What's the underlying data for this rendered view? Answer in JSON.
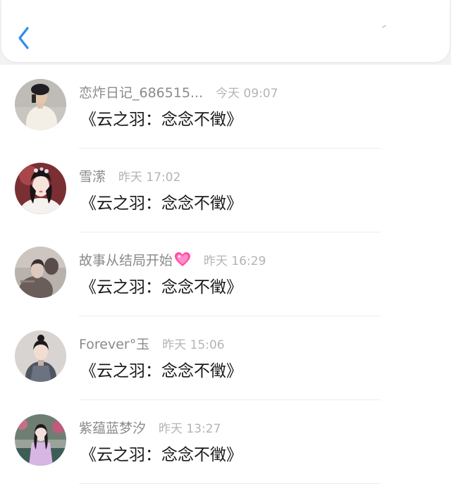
{
  "header": {
    "back_icon": "chevron-left-icon",
    "accent_color": "#2f8cf2"
  },
  "messages": [
    {
      "name": "恋炸日记_686515...",
      "time": "今天 09:07",
      "text": "《云之羽：念念不徵》",
      "avatar": "person-avatar"
    },
    {
      "name": "雪潆",
      "time": "昨天 17:02",
      "text": "《云之羽：念念不徵》",
      "avatar": "person-avatar"
    },
    {
      "name": "故事从结局开始",
      "badge_icon": "heart-emoji-icon",
      "time": "昨天 16:29",
      "text": "《云之羽：念念不徵》",
      "avatar": "person-avatar"
    },
    {
      "name": "Forever°玉",
      "time": "昨天 15:06",
      "text": "《云之羽：念念不徵》",
      "avatar": "person-avatar"
    },
    {
      "name": "紫蕴蓝梦汐",
      "time": "昨天 13:27",
      "text": "《云之羽：念念不徵》",
      "avatar": "person-avatar"
    }
  ]
}
